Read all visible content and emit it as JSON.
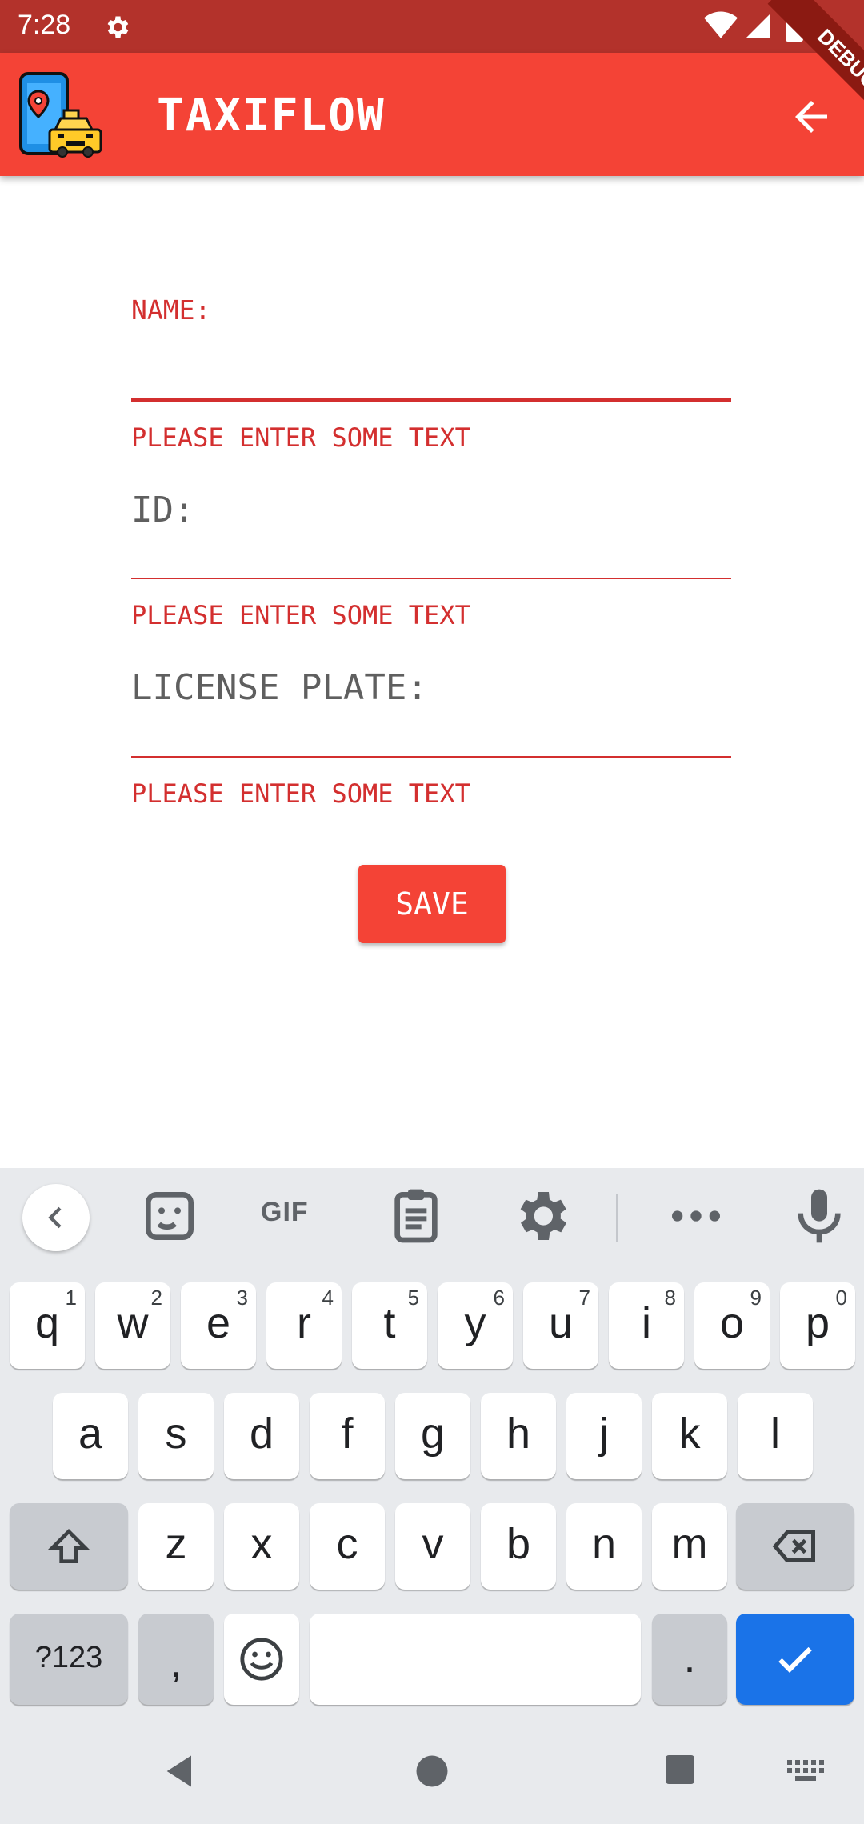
{
  "status_bar": {
    "time": "7:28",
    "icons": [
      "settings-gear-icon",
      "wifi-icon",
      "cell-signal-icon",
      "battery-icon"
    ]
  },
  "app_bar": {
    "title": "TAXIFLOW",
    "logo_icon": "phone-taxi-location-icon",
    "back_icon": "arrow-back-icon",
    "debug_ribbon": "DEBUG",
    "colors": {
      "app_bar": "#f44336",
      "status_bar": "#b3322b"
    }
  },
  "form": {
    "fields": [
      {
        "label": "NAME:",
        "error": "PLEASE ENTER SOME TEXT"
      },
      {
        "label": "ID:",
        "error": "PLEASE ENTER SOME TEXT"
      },
      {
        "label": "LICENSE PLATE:",
        "error": "PLEASE ENTER SOME TEXT"
      }
    ],
    "save_label": "SAVE",
    "colors": {
      "error": "#d32f2f",
      "label_idle": "#5f5f5f"
    }
  },
  "keyboard": {
    "toolbar": {
      "icons": [
        "chevron-left-icon",
        "sticker-icon",
        "gif-icon",
        "clipboard-icon",
        "settings-icon",
        "more-icon",
        "microphone-icon"
      ],
      "gif_label": "GIF"
    },
    "row1": [
      {
        "ch": "q",
        "n": "1"
      },
      {
        "ch": "w",
        "n": "2"
      },
      {
        "ch": "e",
        "n": "3"
      },
      {
        "ch": "r",
        "n": "4"
      },
      {
        "ch": "t",
        "n": "5"
      },
      {
        "ch": "y",
        "n": "6"
      },
      {
        "ch": "u",
        "n": "7"
      },
      {
        "ch": "i",
        "n": "8"
      },
      {
        "ch": "o",
        "n": "9"
      },
      {
        "ch": "p",
        "n": "0"
      }
    ],
    "row2": [
      "a",
      "s",
      "d",
      "f",
      "g",
      "h",
      "j",
      "k",
      "l"
    ],
    "row3": [
      "z",
      "x",
      "c",
      "v",
      "b",
      "n",
      "m"
    ],
    "row4": {
      "symbols": "?123",
      "comma": ",",
      "period": "."
    },
    "icons": {
      "shift": "shift-icon",
      "backspace": "backspace-icon",
      "emoji": "emoji-icon",
      "enter": "checkmark-icon"
    },
    "colors": {
      "enter": "#1a73e8",
      "background": "#e8eaed"
    }
  },
  "nav_bar": {
    "icons": [
      "back-triangle-icon",
      "home-circle-icon",
      "recents-square-icon",
      "keyboard-switch-icon"
    ]
  }
}
